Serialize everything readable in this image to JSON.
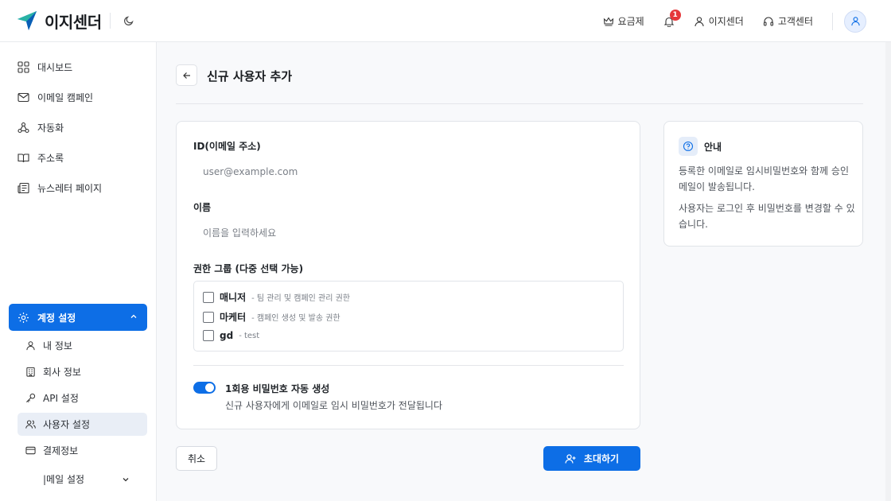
{
  "app": {
    "name": "이지센더"
  },
  "header": {
    "pricing_label": "요금제",
    "notification_count": "1",
    "user_label": "이지센더",
    "support_label": "고객센터"
  },
  "sidebar": {
    "items": [
      {
        "label": "대시보드",
        "icon": "dashboard-icon"
      },
      {
        "label": "이메일 캠페인",
        "icon": "mail-icon"
      },
      {
        "label": "자동화",
        "icon": "automation-icon"
      },
      {
        "label": "주소록",
        "icon": "book-icon"
      },
      {
        "label": "뉴스레터 페이지",
        "icon": "newsletter-icon"
      }
    ],
    "settings_label": "계정 설정",
    "sub_items": [
      {
        "label": "내 정보",
        "icon": "user-icon"
      },
      {
        "label": "회사 정보",
        "icon": "building-icon"
      },
      {
        "label": "API 설정",
        "icon": "key-icon"
      },
      {
        "label": "사용자 설정",
        "icon": "users-icon",
        "active": true
      },
      {
        "label": "결제정보",
        "icon": "card-icon"
      },
      {
        "label": "|메일 설정",
        "icon": "chevron-down-icon"
      }
    ]
  },
  "page": {
    "title": "신규 사용자 추가"
  },
  "form": {
    "email_label": "ID(이메일 주소)",
    "email_placeholder": "user@example.com",
    "name_label": "이름",
    "name_placeholder": "이름을 입력하세요",
    "roles_label": "권한 그룹 (다중 선택 가능)",
    "roles": [
      {
        "name": "매니저",
        "desc": "- 팀 관리 및 캠페인 관리 권한",
        "checked": false
      },
      {
        "name": "마케터",
        "desc": "- 캠페인 생성 및 발송 권한",
        "checked": false
      },
      {
        "name": "gd",
        "desc": "- test",
        "checked": false
      }
    ],
    "otp_label": "1회용 비밀번호 자동 생성",
    "otp_desc": "신규 사용자에게 이메일로 임시 비밀번호가 전달됩니다",
    "otp_enabled": true
  },
  "info": {
    "title": "안내",
    "para1": "등록한 이메일로 임시비밀번호와 함께 승인 메일이 발송됩니다.",
    "para2": "사용자는 로그인 후 비밀번호를 변경할 수 있습니다."
  },
  "actions": {
    "cancel_label": "취소",
    "invite_label": "초대하기"
  },
  "colors": {
    "primary": "#0d6ee6",
    "badge": "#e5383b"
  }
}
